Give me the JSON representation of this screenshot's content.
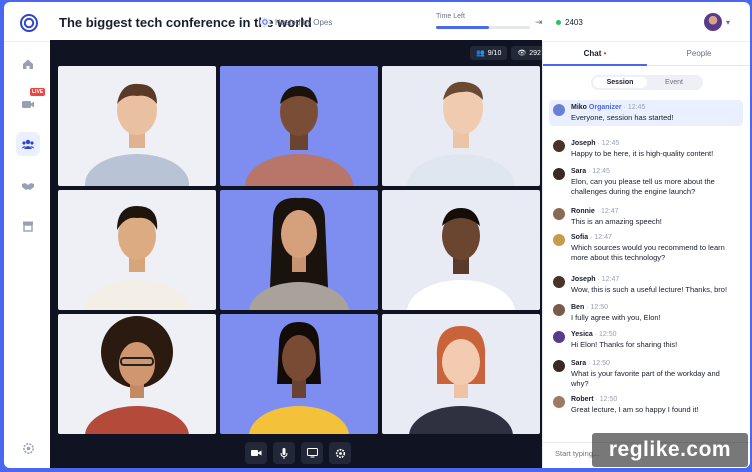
{
  "header": {
    "title": "The biggest tech conference in the world",
    "hosted_by": "Hosted by Opes",
    "time_left_label": "Time Left",
    "time_left_progress": 0.56,
    "viewer_count": "2403"
  },
  "sidebar": {
    "live_badge": "LIVE",
    "items": [
      "home-icon",
      "video-live-icon",
      "people-group-icon",
      "handshake-icon",
      "store-icon"
    ],
    "active_index": 2
  },
  "stage": {
    "participants": "9/10",
    "viewers": "292",
    "controls": [
      "camera-icon",
      "microphone-icon",
      "screen-share-icon",
      "settings-icon"
    ]
  },
  "chat": {
    "tabs": [
      "Chat",
      "People"
    ],
    "active_tab": "Chat",
    "segments": [
      "Session",
      "Event"
    ],
    "active_segment": "Session",
    "input_placeholder": "Start typing...",
    "messages": [
      {
        "name": "Miko",
        "role": "Organizer",
        "time": "· 12:45",
        "text": "Everyone, session has started!",
        "color": "#6b7fd7"
      },
      {
        "name": "Joseph",
        "role": "",
        "time": "· 12:45",
        "text": "Happy to be here, it is high-quality content!",
        "color": "#4a3328"
      },
      {
        "name": "Sara",
        "role": "",
        "time": "· 12:45",
        "text": "Elon, can you please tell us more about the challenges during the engine launch?",
        "color": "#3b2a22"
      },
      {
        "name": "Ronnie",
        "role": "",
        "time": "· 12:47",
        "text": "This is an amazing speech!",
        "color": "#8a6a55"
      },
      {
        "name": "Sofia",
        "role": "",
        "time": "· 12:47",
        "text": "Which sources would you recommend to learn more about this technology?",
        "color": "#c99a4a"
      },
      {
        "name": "Joseph",
        "role": "",
        "time": "· 12:47",
        "text": "Wow, this is such a useful lecture! Thanks, bro!",
        "color": "#4a3328"
      },
      {
        "name": "Ben",
        "role": "",
        "time": "· 12:50",
        "text": "I fully agree with you, Elon!",
        "color": "#7a5a48"
      },
      {
        "name": "Yesica",
        "role": "",
        "time": "· 12:50",
        "text": "Hi Elon! Thanks for sharing this!",
        "color": "#5a3b8a"
      },
      {
        "name": "Sara",
        "role": "",
        "time": "· 12:50",
        "text": "What is your favorite part of the workday and why?",
        "color": "#3b2a22"
      },
      {
        "name": "Robert",
        "role": "",
        "time": "· 12:50",
        "text": "Great lecture, I am so happy I found it!",
        "color": "#a07a60"
      }
    ]
  },
  "watermark": "reglike.com"
}
